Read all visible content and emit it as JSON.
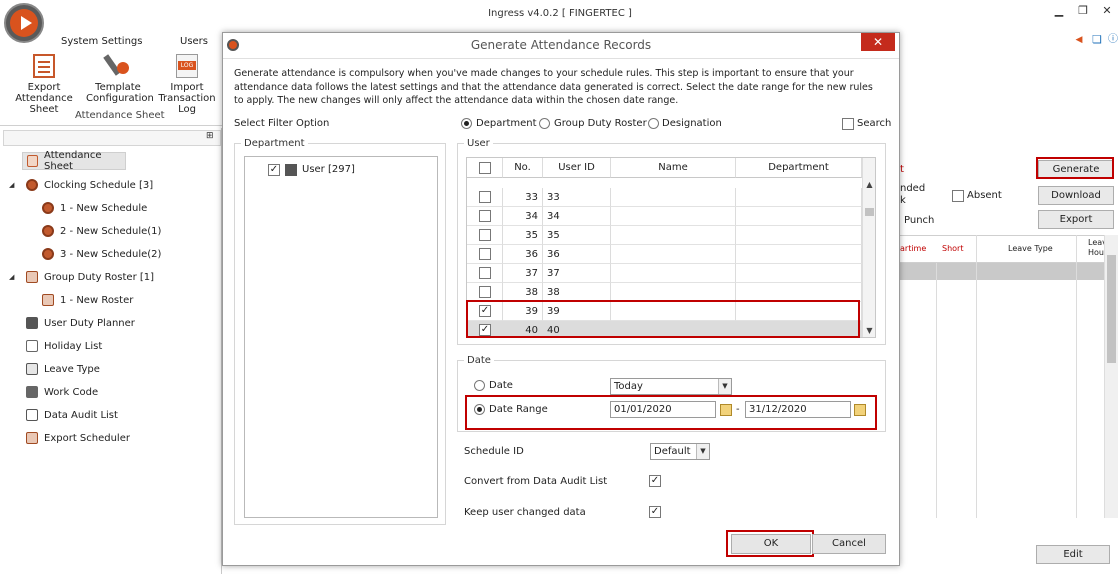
{
  "app": {
    "title": "Ingress v4.0.2 [ FINGERTEC ]"
  },
  "ribbon": {
    "tabs": [
      "System Settings",
      "Users"
    ],
    "buttons": [
      {
        "line1": "Export",
        "line2": "Attendance Sheet"
      },
      {
        "line1": "Template",
        "line2": "Configuration"
      },
      {
        "line1": "Import",
        "line2": "Transaction Log"
      }
    ],
    "group_label": "Attendance Sheet"
  },
  "nav": {
    "items": [
      {
        "label": "Attendance Sheet"
      },
      {
        "label": "Clocking Schedule [3]"
      },
      {
        "label": "1 - New Schedule"
      },
      {
        "label": "2 - New Schedule(1)"
      },
      {
        "label": "3 - New Schedule(2)"
      },
      {
        "label": "Group Duty Roster [1]"
      },
      {
        "label": "1 - New Roster"
      },
      {
        "label": "User Duty Planner"
      },
      {
        "label": "Holiday List"
      },
      {
        "label": "Leave Type"
      },
      {
        "label": "Work Code"
      },
      {
        "label": "Data Audit List"
      },
      {
        "label": "Export Scheduler"
      }
    ]
  },
  "right_pane": {
    "generate": "Generate",
    "download": "Download",
    "export": "Export",
    "edit": "Edit",
    "absent": "Absent",
    "partial_t": "t",
    "partial_nded": "nded",
    "partial_k": "k",
    "punch": "Punch",
    "col_overtime": "artime",
    "col_short": "Short",
    "col_leave_type": "Leave Type",
    "col_leave_hours": "Leav\nHou"
  },
  "dialog": {
    "title": "Generate Attendance Records",
    "close": "✕",
    "description": "Generate attendance is compulsory when you've made changes to your schedule rules. This step is important to ensure that your attendance data follows the latest settings and that the attendance data generated is correct. Select the date range for the new rules to apply. The new changes will only affect the attendance data within the chosen date range.",
    "filter_label": "Select Filter Option",
    "filter_options": [
      "Department",
      "Group Duty Roster",
      "Designation"
    ],
    "filter_selected": "Department",
    "search_label": "Search",
    "department_group": "Department",
    "department_tree_item": "User [297]",
    "user_group": "User",
    "grid_columns": [
      "No.",
      "User ID",
      "Name",
      "Department"
    ],
    "grid_rows": [
      {
        "no": "33",
        "id": "33",
        "checked": false
      },
      {
        "no": "34",
        "id": "34",
        "checked": false
      },
      {
        "no": "35",
        "id": "35",
        "checked": false
      },
      {
        "no": "36",
        "id": "36",
        "checked": false
      },
      {
        "no": "37",
        "id": "37",
        "checked": false
      },
      {
        "no": "38",
        "id": "38",
        "checked": false
      },
      {
        "no": "39",
        "id": "39",
        "checked": true
      },
      {
        "no": "40",
        "id": "40",
        "checked": true
      }
    ],
    "date_group": "Date",
    "date_option": "Date",
    "date_value": "Today",
    "date_range_option": "Date Range",
    "date_from": "01/01/2020",
    "date_sep": "-",
    "date_to": "31/12/2020",
    "schedule_id_label": "Schedule ID",
    "schedule_id_value": "Default",
    "convert_label": "Convert from Data Audit List",
    "keep_label": "Keep user changed data",
    "ok": "OK",
    "cancel": "Cancel"
  },
  "colors": {
    "accent": "#d9531e",
    "highlight": "#c00000",
    "selection": "#dcdcdc"
  }
}
